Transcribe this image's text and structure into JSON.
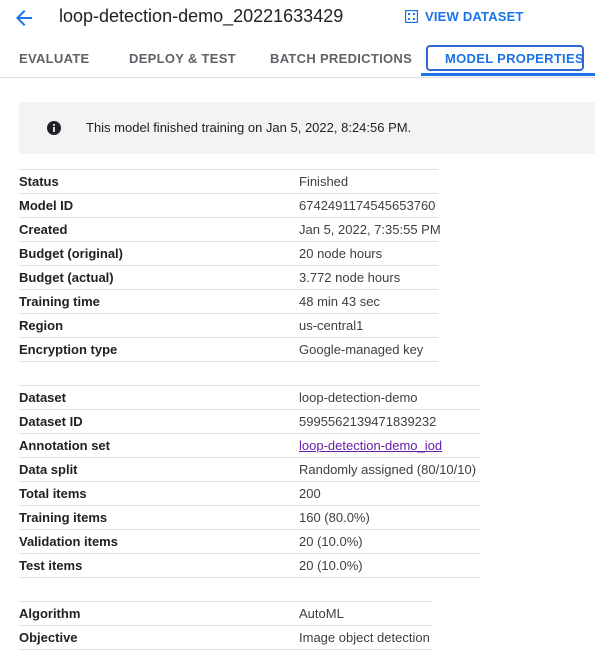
{
  "header": {
    "title": "loop-detection-demo_20221633429",
    "view_dataset_label": "VIEW DATASET"
  },
  "tabs": [
    {
      "label": "EVALUATE",
      "active": false
    },
    {
      "label": "DEPLOY & TEST",
      "active": false
    },
    {
      "label": "BATCH PREDICTIONS",
      "active": false
    },
    {
      "label": "MODEL PROPERTIES",
      "active": true
    }
  ],
  "banner": {
    "icon": "info-icon",
    "message": "This model finished training on Jan 5, 2022, 8:24:56 PM."
  },
  "model_properties": [
    {
      "label": "Status",
      "value": "Finished"
    },
    {
      "label": "Model ID",
      "value": "6742491174545653760"
    },
    {
      "label": "Created",
      "value": "Jan 5, 2022, 7:35:55 PM"
    },
    {
      "label": "Budget (original)",
      "value": "20 node hours"
    },
    {
      "label": "Budget (actual)",
      "value": "3.772 node hours"
    },
    {
      "label": "Training time",
      "value": "48 min 43 sec"
    },
    {
      "label": "Region",
      "value": "us-central1"
    },
    {
      "label": "Encryption type",
      "value": "Google-managed key"
    }
  ],
  "dataset_properties": [
    {
      "label": "Dataset",
      "value": "loop-detection-demo"
    },
    {
      "label": "Dataset ID",
      "value": "5995562139471839232"
    },
    {
      "label": "Annotation set",
      "value": "loop-detection-demo_iod",
      "link": true
    },
    {
      "label": "Data split",
      "value": "Randomly assigned (80/10/10)"
    },
    {
      "label": "Total items",
      "value": "200"
    },
    {
      "label": "Training items",
      "value": "160 (80.0%)"
    },
    {
      "label": "Validation items",
      "value": "20 (10.0%)"
    },
    {
      "label": "Test items",
      "value": "20 (10.0%)"
    }
  ],
  "algorithm_properties": [
    {
      "label": "Algorithm",
      "value": "AutoML"
    },
    {
      "label": "Objective",
      "value": "Image object detection"
    }
  ],
  "colors": {
    "accent": "#1a73e8",
    "link_visited": "#681da8",
    "banner_bg": "#f1f3f4"
  }
}
